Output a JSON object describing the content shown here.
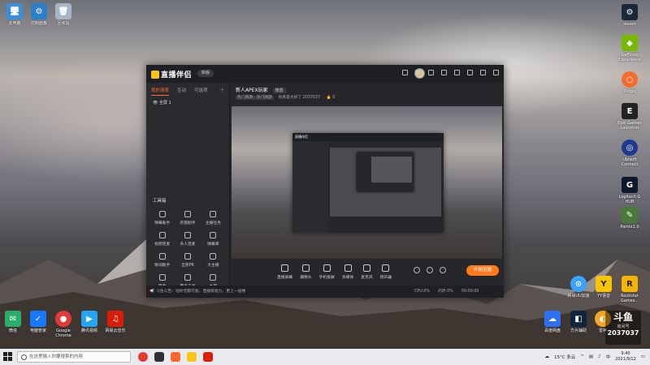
{
  "desktop": {
    "left_icons": [
      {
        "label": "此电脑",
        "color": "#3b8fd8"
      },
      {
        "label": "控制面板",
        "color": "#2f7ec8"
      },
      {
        "label": "回收站",
        "color": "#a7b6c6"
      }
    ],
    "right_icons": [
      {
        "label": "steam",
        "color": "#1b2838"
      },
      {
        "label": "GeForce Experience",
        "color": "#76b900"
      },
      {
        "label": "Origin",
        "color": "#f56c2d"
      },
      {
        "label": "Epic Games Launcher",
        "color": "#222222"
      },
      {
        "label": "Ubisoft Connect",
        "color": "#1e3a8a"
      },
      {
        "label": "Logitech G HUB",
        "color": "#0f172a"
      },
      {
        "label": "Paintx1.0",
        "color": "#4a7a3a"
      }
    ],
    "bottom_left_icons": [
      {
        "label": "微信",
        "color": "#2aae67"
      },
      {
        "label": "电脑管家",
        "color": "#1677ff"
      },
      {
        "label": "Google Chrome",
        "color": "#e53935"
      },
      {
        "label": "腾讯视频",
        "color": "#26a4f5"
      },
      {
        "label": "网易云音乐",
        "color": "#d81e06"
      }
    ],
    "bottom_right_icons": [
      {
        "label": "百度网盘",
        "color": "#2f6ff2"
      },
      {
        "label": "方片辅助",
        "color": "#10243c"
      },
      {
        "label": "雷神",
        "color": "#f5a524"
      },
      {
        "label": "网易UU加速",
        "color": "#3aa3ff"
      },
      {
        "label": "YY语音",
        "color": "#f7c600"
      },
      {
        "label": "Rockstar Games...",
        "color": "#f4b400"
      }
    ]
  },
  "app": {
    "name": "直播伴侣",
    "version_badge": "新版",
    "left_tabs": [
      "我的场景",
      "互动",
      "可选项"
    ],
    "scene_label": "全屏 1",
    "tools_title": "工具箱",
    "tools": [
      "弹幕助手",
      "房管助手",
      "主播任务",
      "视频连麦",
      "多人连麦",
      "弹幕库",
      "歌词助手",
      "全民PK",
      "大主播",
      "节奏",
      "更多工具",
      "主页"
    ],
    "stream_title": "新人APEX玩家",
    "edit_label": "修改",
    "category_tag": "热门网游 · 热门网游",
    "room_info": "你真是太好了 2037037",
    "hot_count": "0",
    "controls": [
      "直播屏幕",
      "摄像头",
      "手机投屏",
      "多媒体",
      "麦克风",
      "扬声器"
    ],
    "start_label": "开始直播",
    "status_message": "斗鱼公告：他你无聊可能，直播有能力，更上一层楼",
    "status_stats": [
      "CPU:0%",
      "内存:0%",
      "00:00:00"
    ]
  },
  "taskbar": {
    "search_placeholder": "在这里输入你要搜索的内容",
    "weather": "15°C 多云",
    "time": "9:40",
    "date": "2021/9/12",
    "lang": "中"
  },
  "watermark": {
    "brand": "斗鱼",
    "room_label": "房间号",
    "room_id": "2037037"
  }
}
